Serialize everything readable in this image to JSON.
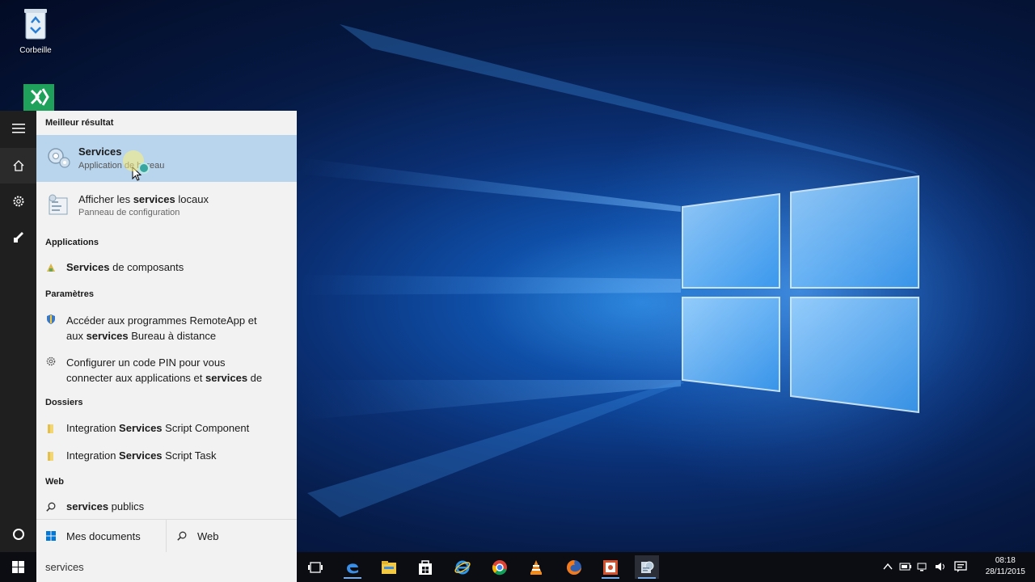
{
  "desktop": {
    "icons": [
      {
        "label": "Corbeille",
        "icon": "recycle-bin-icon"
      },
      {
        "label": "",
        "icon": "visual-studio-icon"
      }
    ]
  },
  "rail": {
    "items": [
      {
        "icon": "hamburger-menu-icon"
      },
      {
        "icon": "home-icon"
      },
      {
        "icon": "settings-gear-icon"
      },
      {
        "icon": "feedback-icon"
      },
      {
        "icon": "cortana-circle-icon"
      }
    ]
  },
  "search": {
    "sections": {
      "best": "Meilleur résultat",
      "apps": "Applications",
      "settings": "Paramètres",
      "folders": "Dossiers",
      "web": "Web"
    },
    "best_result": {
      "title": "Services",
      "subtitle": "Application de bureau"
    },
    "second_result": {
      "title_pre": "Afficher les ",
      "title_bold": "services",
      "title_post": " locaux",
      "subtitle": "Panneau de configuration"
    },
    "app_item": {
      "bold": "Services",
      "rest": " de composants"
    },
    "settings_items": [
      {
        "line1": "Accéder aux programmes RemoteApp et",
        "line2_pre": "aux ",
        "line2_bold": "services",
        "line2_post": " Bureau à distance"
      },
      {
        "line1": "Configurer un code PIN pour vous",
        "line2_pre": "connecter aux applications et ",
        "line2_bold": "services",
        "line2_post": " de"
      }
    ],
    "folder_items": [
      {
        "pre": "Integration ",
        "bold": "Services",
        "post": " Script Component"
      },
      {
        "pre": "Integration ",
        "bold": "Services",
        "post": " Script Task"
      }
    ],
    "web_item": {
      "bold": "services",
      "rest": " publics"
    },
    "bottom": {
      "my_docs": "Mes documents",
      "web": "Web"
    },
    "query": "services"
  },
  "taskbar": {
    "apps": [
      "task-view-icon",
      "edge-icon",
      "file-explorer-icon",
      "store-icon",
      "internet-explorer-icon",
      "chrome-icon",
      "vlc-icon",
      "firefox-icon",
      "powerpoint-icon",
      "services-app-icon"
    ],
    "time": "08:18",
    "date": "28/11/2015"
  },
  "colors": {
    "accent": "#0078d7",
    "highlight": "#b9d5ee"
  }
}
